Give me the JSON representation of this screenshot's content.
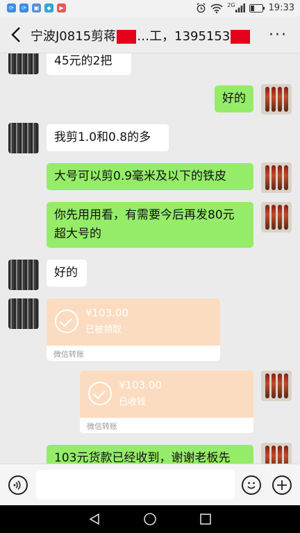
{
  "status_bar": {
    "time": "19:33",
    "network": "2G",
    "left_icons": [
      "sync-icon",
      "sync-icon",
      "image-icon",
      "shield-icon",
      "video-icon"
    ],
    "right_icons": [
      "alarm-icon",
      "wifi-icon",
      "signal-icon",
      "battery-icon"
    ]
  },
  "header": {
    "title_part1": "宁波J0815剪蒋",
    "title_part2": "…工，1395153",
    "title_part3": "",
    "back_icon": "back-chevron-icon",
    "more_icon": "more-dots-icon"
  },
  "messages": [
    {
      "side": "left",
      "text": "45元的2把"
    },
    {
      "side": "right",
      "text": "好的"
    },
    {
      "side": "left",
      "text": "我剪1.0和0.8的多"
    },
    {
      "side": "right",
      "text": "大号可以剪0.9毫米及以下的铁皮"
    },
    {
      "side": "right",
      "text": "你先用用看，有需要今后再发80元超大号的"
    },
    {
      "side": "left",
      "text": "好的"
    },
    {
      "side": "right",
      "text": "103元货款已经收到，谢谢老板先"
    }
  ],
  "transfers": [
    {
      "side": "left",
      "amount": "¥103.00",
      "status": "已被领取",
      "label": "微信转账"
    },
    {
      "side": "right",
      "amount": "¥103.00",
      "status": "已收钱",
      "label": "微信转账"
    }
  ],
  "input_bar": {
    "voice_icon": "voice-icon",
    "emoji_icon": "emoji-icon",
    "plus_icon": "plus-icon",
    "value": ""
  },
  "nav_bar": {
    "icons": [
      "back-triangle-icon",
      "home-circle-icon",
      "recents-square-icon"
    ]
  },
  "colors": {
    "accent_green": "#95ec69",
    "transfer_orange": "#fbdcc0",
    "redaction_red": "#e4001b"
  }
}
